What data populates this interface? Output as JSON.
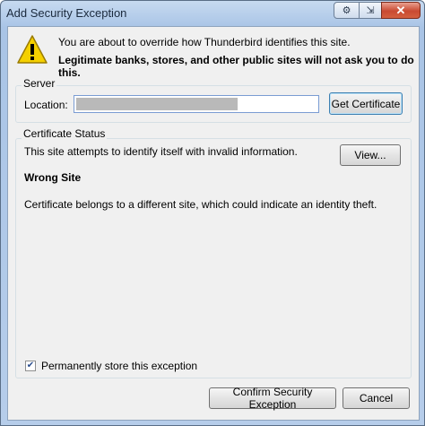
{
  "window": {
    "title": "Add Security Exception"
  },
  "warning": {
    "line1": "You are about to override how Thunderbird identifies this site.",
    "line2": "Legitimate banks, stores, and other public sites will not ask you to do this."
  },
  "server": {
    "group_label": "Server",
    "location_label": "Location:",
    "location_value": "",
    "get_certificate_label": "Get Certificate"
  },
  "certificate_status": {
    "group_label": "Certificate Status",
    "message": "This site attempts to identify itself with invalid information.",
    "view_label": "View...",
    "error_title": "Wrong Site",
    "error_description": "Certificate belongs to a different site, which could indicate an identity theft."
  },
  "permanent_store": {
    "label": "Permanently store this exception",
    "checked": true
  },
  "footer": {
    "confirm_label": "Confirm Security Exception",
    "cancel_label": "Cancel"
  },
  "colors": {
    "titlebar": "#b6cdea",
    "close_button": "#c94a31",
    "warning_yellow": "#f5d000"
  }
}
